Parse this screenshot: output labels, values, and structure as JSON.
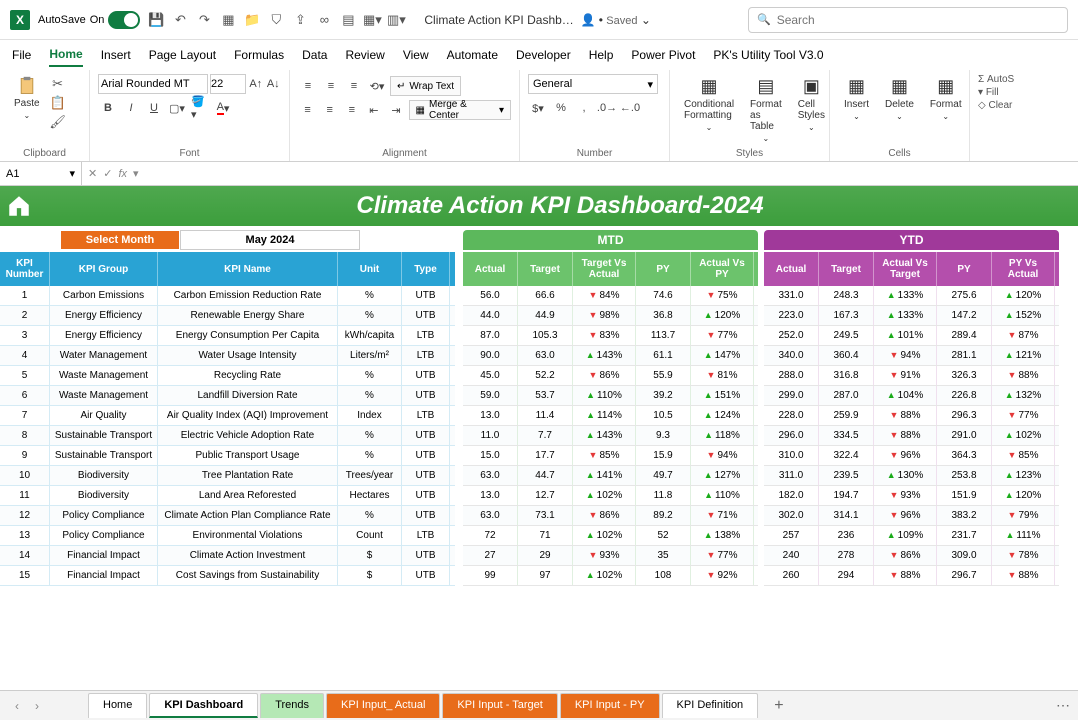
{
  "titlebar": {
    "autosave_label": "AutoSave",
    "autosave_state": "On",
    "doc_title": "Climate Action KPI Dashb…",
    "saved_label": "Saved",
    "search_placeholder": "Search"
  },
  "menu": [
    "File",
    "Home",
    "Insert",
    "Page Layout",
    "Formulas",
    "Data",
    "Review",
    "View",
    "Automate",
    "Developer",
    "Help",
    "Power Pivot",
    "PK's Utility Tool V3.0"
  ],
  "menu_active_index": 1,
  "ribbon": {
    "paste": "Paste",
    "clipboard": "Clipboard",
    "font_name": "Arial Rounded MT",
    "font_size": "22",
    "font_group": "Font",
    "wrap_text": "Wrap Text",
    "merge_center": "Merge & Center",
    "alignment": "Alignment",
    "number_format": "General",
    "number_group": "Number",
    "cond_fmt": "Conditional Formatting",
    "fmt_table": "Format as Table",
    "cell_styles": "Cell Styles",
    "styles_group": "Styles",
    "insert": "Insert",
    "delete": "Delete",
    "format": "Format",
    "cells_group": "Cells",
    "autosum": "AutoS",
    "fill": "Fill",
    "clear": "Clear"
  },
  "formula_bar": {
    "cell_ref": "A1",
    "fx": "fx"
  },
  "dashboard": {
    "title": "Climate Action KPI Dashboard-2024",
    "select_month_label": "Select Month",
    "selected_month": "May 2024",
    "mtd_label": "MTD",
    "ytd_label": "YTD"
  },
  "columns_left": [
    "KPI Number",
    "KPI Group",
    "KPI Name",
    "Unit",
    "Type"
  ],
  "columns_mtd": [
    "Actual",
    "Target",
    "Target Vs Actual",
    "PY",
    "Actual Vs PY"
  ],
  "columns_ytd": [
    "Actual",
    "Target",
    "Actual Vs Target",
    "PY",
    "PY Vs Actual"
  ],
  "rows": [
    {
      "num": 1,
      "group": "Carbon Emissions",
      "name": "Carbon Emission Reduction Rate",
      "unit": "%",
      "type": "UTB",
      "mtd": {
        "act": "56.0",
        "tgt": "66.6",
        "tva": "84%",
        "tva_dir": "dn",
        "py": "74.6",
        "apy": "75%",
        "apy_dir": "dn"
      },
      "ytd": {
        "act": "331.0",
        "tgt": "248.3",
        "avt": "133%",
        "avt_dir": "up",
        "py": "275.6",
        "pva": "120%",
        "pva_dir": "up"
      }
    },
    {
      "num": 2,
      "group": "Energy Efficiency",
      "name": "Renewable Energy Share",
      "unit": "%",
      "type": "UTB",
      "mtd": {
        "act": "44.0",
        "tgt": "44.9",
        "tva": "98%",
        "tva_dir": "dn",
        "py": "36.8",
        "apy": "120%",
        "apy_dir": "up"
      },
      "ytd": {
        "act": "223.0",
        "tgt": "167.3",
        "avt": "133%",
        "avt_dir": "up",
        "py": "147.2",
        "pva": "152%",
        "pva_dir": "up"
      }
    },
    {
      "num": 3,
      "group": "Energy Efficiency",
      "name": "Energy Consumption Per Capita",
      "unit": "kWh/capita",
      "type": "LTB",
      "mtd": {
        "act": "87.0",
        "tgt": "105.3",
        "tva": "83%",
        "tva_dir": "dn",
        "py": "113.7",
        "apy": "77%",
        "apy_dir": "dn"
      },
      "ytd": {
        "act": "252.0",
        "tgt": "249.5",
        "avt": "101%",
        "avt_dir": "up",
        "py": "289.4",
        "pva": "87%",
        "pva_dir": "dn"
      }
    },
    {
      "num": 4,
      "group": "Water Management",
      "name": "Water Usage Intensity",
      "unit": "Liters/m²",
      "type": "LTB",
      "mtd": {
        "act": "90.0",
        "tgt": "63.0",
        "tva": "143%",
        "tva_dir": "up",
        "py": "61.1",
        "apy": "147%",
        "apy_dir": "up"
      },
      "ytd": {
        "act": "340.0",
        "tgt": "360.4",
        "avt": "94%",
        "avt_dir": "dn",
        "py": "281.1",
        "pva": "121%",
        "pva_dir": "up"
      }
    },
    {
      "num": 5,
      "group": "Waste Management",
      "name": "Recycling Rate",
      "unit": "%",
      "type": "UTB",
      "mtd": {
        "act": "45.0",
        "tgt": "52.2",
        "tva": "86%",
        "tva_dir": "dn",
        "py": "55.9",
        "apy": "81%",
        "apy_dir": "dn"
      },
      "ytd": {
        "act": "288.0",
        "tgt": "316.8",
        "avt": "91%",
        "avt_dir": "dn",
        "py": "326.3",
        "pva": "88%",
        "pva_dir": "dn"
      }
    },
    {
      "num": 6,
      "group": "Waste Management",
      "name": "Landfill Diversion Rate",
      "unit": "%",
      "type": "UTB",
      "mtd": {
        "act": "59.0",
        "tgt": "53.7",
        "tva": "110%",
        "tva_dir": "up",
        "py": "39.2",
        "apy": "151%",
        "apy_dir": "up"
      },
      "ytd": {
        "act": "299.0",
        "tgt": "287.0",
        "avt": "104%",
        "avt_dir": "up",
        "py": "226.8",
        "pva": "132%",
        "pva_dir": "up"
      }
    },
    {
      "num": 7,
      "group": "Air Quality",
      "name": "Air Quality Index (AQI) Improvement",
      "unit": "Index",
      "type": "LTB",
      "mtd": {
        "act": "13.0",
        "tgt": "11.4",
        "tva": "114%",
        "tva_dir": "up",
        "py": "10.5",
        "apy": "124%",
        "apy_dir": "up"
      },
      "ytd": {
        "act": "228.0",
        "tgt": "259.9",
        "avt": "88%",
        "avt_dir": "dn",
        "py": "296.3",
        "pva": "77%",
        "pva_dir": "dn"
      }
    },
    {
      "num": 8,
      "group": "Sustainable Transport",
      "name": "Electric Vehicle Adoption Rate",
      "unit": "%",
      "type": "UTB",
      "mtd": {
        "act": "11.0",
        "tgt": "7.7",
        "tva": "143%",
        "tva_dir": "up",
        "py": "9.3",
        "apy": "118%",
        "apy_dir": "up"
      },
      "ytd": {
        "act": "296.0",
        "tgt": "334.5",
        "avt": "88%",
        "avt_dir": "dn",
        "py": "291.0",
        "pva": "102%",
        "pva_dir": "up"
      }
    },
    {
      "num": 9,
      "group": "Sustainable Transport",
      "name": "Public Transport Usage",
      "unit": "%",
      "type": "UTB",
      "mtd": {
        "act": "15.0",
        "tgt": "17.7",
        "tva": "85%",
        "tva_dir": "dn",
        "py": "15.9",
        "apy": "94%",
        "apy_dir": "dn"
      },
      "ytd": {
        "act": "310.0",
        "tgt": "322.4",
        "avt": "96%",
        "avt_dir": "dn",
        "py": "364.3",
        "pva": "85%",
        "pva_dir": "dn"
      }
    },
    {
      "num": 10,
      "group": "Biodiversity",
      "name": "Tree Plantation Rate",
      "unit": "Trees/year",
      "type": "UTB",
      "mtd": {
        "act": "63.0",
        "tgt": "44.7",
        "tva": "141%",
        "tva_dir": "up",
        "py": "49.7",
        "apy": "127%",
        "apy_dir": "up"
      },
      "ytd": {
        "act": "311.0",
        "tgt": "239.5",
        "avt": "130%",
        "avt_dir": "up",
        "py": "253.8",
        "pva": "123%",
        "pva_dir": "up"
      }
    },
    {
      "num": 11,
      "group": "Biodiversity",
      "name": "Land Area Reforested",
      "unit": "Hectares",
      "type": "UTB",
      "mtd": {
        "act": "13.0",
        "tgt": "12.7",
        "tva": "102%",
        "tva_dir": "up",
        "py": "11.8",
        "apy": "110%",
        "apy_dir": "up"
      },
      "ytd": {
        "act": "182.0",
        "tgt": "194.7",
        "avt": "93%",
        "avt_dir": "dn",
        "py": "151.9",
        "pva": "120%",
        "pva_dir": "up"
      }
    },
    {
      "num": 12,
      "group": "Policy Compliance",
      "name": "Climate Action Plan Compliance Rate",
      "unit": "%",
      "type": "UTB",
      "mtd": {
        "act": "63.0",
        "tgt": "73.1",
        "tva": "86%",
        "tva_dir": "dn",
        "py": "89.2",
        "apy": "71%",
        "apy_dir": "dn"
      },
      "ytd": {
        "act": "302.0",
        "tgt": "314.1",
        "avt": "96%",
        "avt_dir": "dn",
        "py": "383.2",
        "pva": "79%",
        "pva_dir": "dn"
      }
    },
    {
      "num": 13,
      "group": "Policy Compliance",
      "name": "Environmental Violations",
      "unit": "Count",
      "type": "LTB",
      "mtd": {
        "act": "72",
        "tgt": "71",
        "tva": "102%",
        "tva_dir": "up",
        "py": "52",
        "apy": "138%",
        "apy_dir": "up"
      },
      "ytd": {
        "act": "257",
        "tgt": "236",
        "avt": "109%",
        "avt_dir": "up",
        "py": "231.7",
        "pva": "111%",
        "pva_dir": "up"
      }
    },
    {
      "num": 14,
      "group": "Financial Impact",
      "name": "Climate Action Investment",
      "unit": "$",
      "type": "UTB",
      "mtd": {
        "act": "27",
        "tgt": "29",
        "tva": "93%",
        "tva_dir": "dn",
        "py": "35",
        "apy": "77%",
        "apy_dir": "dn"
      },
      "ytd": {
        "act": "240",
        "tgt": "278",
        "avt": "86%",
        "avt_dir": "dn",
        "py": "309.0",
        "pva": "78%",
        "pva_dir": "dn"
      }
    },
    {
      "num": 15,
      "group": "Financial Impact",
      "name": "Cost Savings from Sustainability",
      "unit": "$",
      "type": "UTB",
      "mtd": {
        "act": "99",
        "tgt": "97",
        "tva": "102%",
        "tva_dir": "up",
        "py": "108",
        "apy": "92%",
        "apy_dir": "dn"
      },
      "ytd": {
        "act": "260",
        "tgt": "294",
        "avt": "88%",
        "avt_dir": "dn",
        "py": "296.7",
        "pva": "88%",
        "pva_dir": "dn"
      }
    }
  ],
  "sheet_tabs": [
    {
      "label": "Home",
      "style": "plain"
    },
    {
      "label": "KPI Dashboard",
      "style": "active"
    },
    {
      "label": "Trends",
      "style": "green"
    },
    {
      "label": "KPI Input_ Actual",
      "style": "orange"
    },
    {
      "label": "KPI Input - Target",
      "style": "orange"
    },
    {
      "label": "KPI Input - PY",
      "style": "orange"
    },
    {
      "label": "KPI Definition",
      "style": "plain"
    }
  ]
}
